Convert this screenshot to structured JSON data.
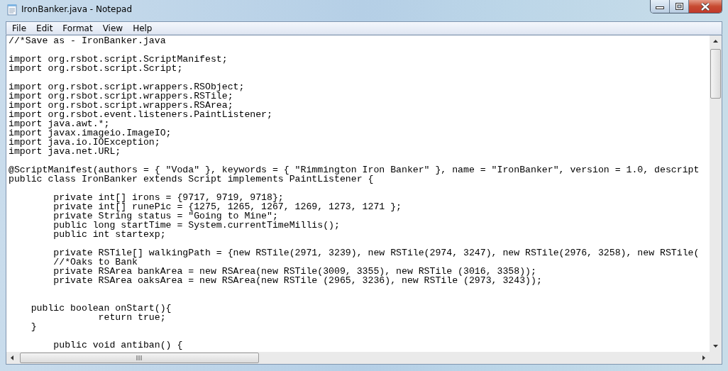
{
  "window": {
    "title": "IronBanker.java - Notepad"
  },
  "menu": [
    "File",
    "Edit",
    "Format",
    "View",
    "Help"
  ],
  "lines": [
    {
      "kind": "code",
      "text": "//*Save as - IronBanker.java"
    },
    {
      "kind": "blank"
    },
    {
      "kind": "code",
      "text": "import org.rsbot.script.ScriptManifest;"
    },
    {
      "kind": "code",
      "text": "import org.rsbot.script.Script;"
    },
    {
      "kind": "blank"
    },
    {
      "kind": "code",
      "text": "import org.rsbot.script.wrappers.RSObject;"
    },
    {
      "kind": "code",
      "text": "import org.rsbot.script.wrappers.RSTile;"
    },
    {
      "kind": "code",
      "text": "import org.rsbot.script.wrappers.RSArea;"
    },
    {
      "kind": "code",
      "text": "import org.rsbot.event.listeners.PaintListener;"
    },
    {
      "kind": "code",
      "text": "import java.awt.*;"
    },
    {
      "kind": "code",
      "text": "import javax.imageio.ImageIO;"
    },
    {
      "kind": "code",
      "text": "import java.io.IOException;"
    },
    {
      "kind": "code",
      "text": "import java.net.URL;"
    },
    {
      "kind": "blank"
    },
    {
      "kind": "code",
      "text": "@ScriptManifest(authors = { \"Voda\" }, keywords = { \"Rimmington Iron Banker\" }, name = \"IronBanker\", version = 1.0, descript"
    },
    {
      "kind": "code",
      "text": "public class IronBanker extends Script implements PaintListener {"
    },
    {
      "kind": "blank"
    },
    {
      "kind": "code",
      "text": "        private int[] irons = {9717, 9719, 9718};"
    },
    {
      "kind": "code",
      "text": "        private int[] runePic = {1275, 1265, 1267, 1269, 1273, 1271 };"
    },
    {
      "kind": "code",
      "text": "        private String status = \"Going to Mine\";"
    },
    {
      "kind": "code",
      "text": "        public long startTime = System.currentTimeMillis();"
    },
    {
      "kind": "code",
      "text": "        public int startexp;"
    },
    {
      "kind": "blank"
    },
    {
      "kind": "code",
      "text": "        private RSTile[] walkingPath = {new RSTile(2971, 3239), new RSTile(2974, 3247), new RSTile(2976, 3258), new RSTile("
    },
    {
      "kind": "code",
      "text": "        //*Oaks to Bank"
    },
    {
      "kind": "code",
      "text": "        private RSArea bankArea = new RSArea(new RSTile(3009, 3355), new RSTile (3016, 3358));"
    },
    {
      "kind": "code",
      "text": "        private RSArea oaksArea = new RSArea(new RSTile (2965, 3236), new RSTile (2973, 3243));"
    },
    {
      "kind": "blank"
    },
    {
      "kind": "blank"
    },
    {
      "kind": "code",
      "text": "    public boolean onStart(){"
    },
    {
      "kind": "code",
      "text": "                return true;"
    },
    {
      "kind": "code",
      "text": "    }"
    },
    {
      "kind": "blank"
    },
    {
      "kind": "code",
      "text": "        public void antiban() {"
    }
  ]
}
